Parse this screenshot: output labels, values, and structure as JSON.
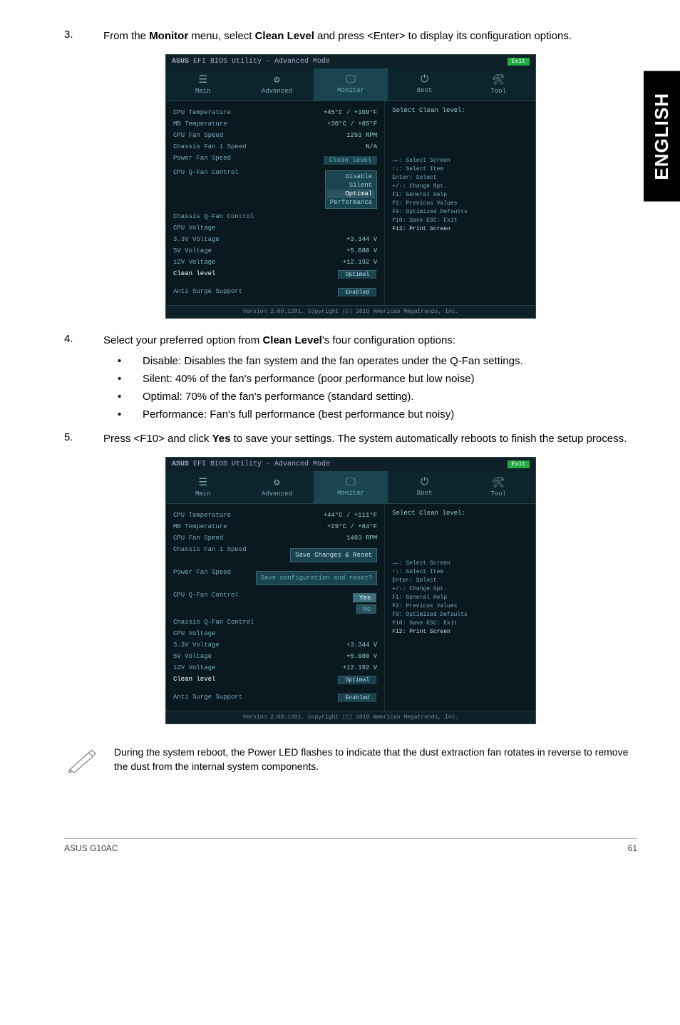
{
  "side_tab": "ENGLISH",
  "step3": {
    "num": "3.",
    "text_before": "From the ",
    "bold1": "Monitor",
    "text_mid": " menu, select ",
    "bold2": "Clean Level",
    "text_after": " and press <Enter> to display its configuration options."
  },
  "step4": {
    "num": "4.",
    "text_before": "Select your preferred option from ",
    "bold": "Clean Level",
    "text_after": "'s four configuration options:",
    "bullets": {
      "b1": "Disable: Disables the fan system and the fan operates under the Q-Fan settings.",
      "b2": "Silent: 40% of the fan's performance (poor performance but low noise)",
      "b3": "Optimal: 70% of the fan's performance (standard setting).",
      "b4": "Performance: Fan's full performance (best performance but noisy)"
    }
  },
  "step5": {
    "num": "5.",
    "text_before": "Press <F10> and click ",
    "bold": "Yes",
    "text_after": " to save your settings. The system automatically reboots to finish the setup process."
  },
  "bios": {
    "title_prefix": "ASUS",
    "title_rest": " EFI BIOS Utility - Advanced Mode",
    "exit": "Exit",
    "tabs": {
      "main": "Main",
      "advanced": "Advanced",
      "monitor": "Monitor",
      "boot": "Boot",
      "tool": "Tool"
    },
    "rows": {
      "cpu_temp": {
        "lbl": "CPU Temperature",
        "val": "+44°C / +111°F"
      },
      "cpu_temp2": {
        "val": "+45°C / +109°F"
      },
      "mb_temp": {
        "lbl": "MB Temperature",
        "val": "+29°C / +84°F"
      },
      "mb_temp2": {
        "val": "+30°C / +85°F"
      },
      "cpu_fan": {
        "lbl": "CPU Fan Speed",
        "val": "1493 RPM"
      },
      "cpu_fan2": {
        "val": "1293 RPM"
      },
      "ch_fan1": {
        "lbl": "Chassis Fan 1 Speed",
        "val": "N/A"
      },
      "pwr_fan": {
        "lbl": "Power Fan Speed"
      },
      "q_fan": {
        "lbl": "CPU Q-Fan Control"
      },
      "ch_q_fan": {
        "lbl": "Chassis Q-Fan Control"
      },
      "cpu_volt": {
        "lbl": "CPU Voltage"
      },
      "v33": {
        "lbl": "3.3V Voltage",
        "val": "+3.344 V"
      },
      "v5": {
        "lbl": "5V Voltage",
        "val": "+5.080 V"
      },
      "v12": {
        "lbl": "12V Voltage",
        "val": "+12.192 V"
      },
      "clean": {
        "lbl": "Clean level",
        "val": "Optimal"
      },
      "anti": {
        "lbl": "Anti Surge Support",
        "val": "Enabled"
      }
    },
    "dropdown": {
      "header": "Clean level",
      "opts": {
        "disable": "Disable",
        "silent": "Silent",
        "optimal": "Optimal",
        "performance": "Performance"
      }
    },
    "dialog": {
      "title": "Save Changes & Reset",
      "msg": "Save configuration and reset?",
      "yes": "Yes",
      "no": "No"
    },
    "right_title": "Select Clean level:",
    "help": {
      "l1": "→←: Select Screen",
      "l2": "↑↓: Select Item",
      "l3": "Enter: Select",
      "l4": "+/-: Change Opt.",
      "l5": "F1: General Help",
      "l6": "F2: Previous Values",
      "l7": "F9: Optimized Defaults",
      "l8": "F10: Save  ESC: Exit",
      "l9": "F12: Print Screen"
    },
    "footer": "Version 2.00.1201. Copyright (C) 2010 American Megatrends, Inc."
  },
  "note": "During the system reboot, the Power LED flashes to indicate that the dust extraction fan rotates in reverse to remove the dust from the internal system components.",
  "footer": {
    "left": "ASUS G10AC",
    "right": "61"
  },
  "chart_data": {
    "type": "table",
    "title": "BIOS Monitor readings (screenshot 1)",
    "rows": [
      {
        "item": "CPU Temperature",
        "value": "+45°C / +109°F"
      },
      {
        "item": "MB Temperature",
        "value": "+30°C / +85°F"
      },
      {
        "item": "CPU Fan Speed",
        "value": "1293 RPM"
      },
      {
        "item": "Chassis Fan 1 Speed",
        "value": "N/A"
      },
      {
        "item": "3.3V Voltage",
        "value": "+3.344 V"
      },
      {
        "item": "5V Voltage",
        "value": "+5.080 V"
      },
      {
        "item": "12V Voltage",
        "value": "+12.192 V"
      },
      {
        "item": "Clean level",
        "value": "Optimal"
      },
      {
        "item": "Anti Surge Support",
        "value": "Enabled"
      }
    ]
  }
}
